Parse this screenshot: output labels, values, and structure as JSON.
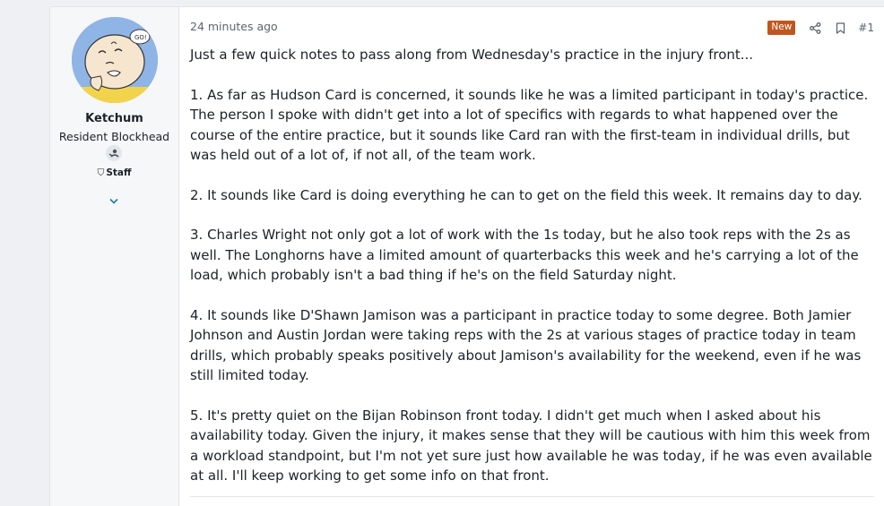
{
  "user": {
    "name": "Ketchum",
    "title": "Resident Blockhead",
    "staff_label": "Staff"
  },
  "post": {
    "timestamp": "24 minutes ago",
    "new_badge": "New",
    "post_number": "#1",
    "paragraphs": [
      "Just a few quick notes to pass along from Wednesday's practice in the injury front...",
      "1. As far as Hudson Card is concerned, it sounds like he was a limited participant in today's practice. The person I spoke with didn't get into a lot of specifics with regards to what happened over the course of the entire practice, but it sounds like Card ran with the first-team in individual drills, but was held out of a lot of, if not all, of the team work.",
      "2. It sounds like Card is doing everything he can to get on the field this week. It remains day to day.",
      "3. Charles Wright not only got a lot of work with the 1s today, but he also took reps with the 2s as well. The Longhorns have a limited amount of quarterbacks this week and he's carrying a lot of the load, which probably isn't a bad thing if he's on the field Saturday night.",
      "4. It sounds like D'Shawn Jamison was a participant in practice today to some degree. Both Jamier Johnson and Austin Jordan were taking reps with the 2s at various stages of practice today in team drills, which probably speaks positively about Jamison's availability for the weekend, even if he was still limited today.",
      "5. It's pretty quiet on the Bijan Robinson front today. I didn't get much when I asked about his availability today. Given the injury, it makes sense that they will be cautious with him this week from a workload standpoint, but I'm not yet sure just how available he was today, if he was even available at all. I'll keep working to get some info on that front."
    ]
  },
  "colors": {
    "accent": "#2577b1",
    "new_badge": "#c0561f",
    "avatar_bg": "#8fb4e6"
  },
  "icons": [
    "share-icon",
    "bookmark-icon",
    "shield-icon",
    "role-icon",
    "chevron-down-icon"
  ]
}
